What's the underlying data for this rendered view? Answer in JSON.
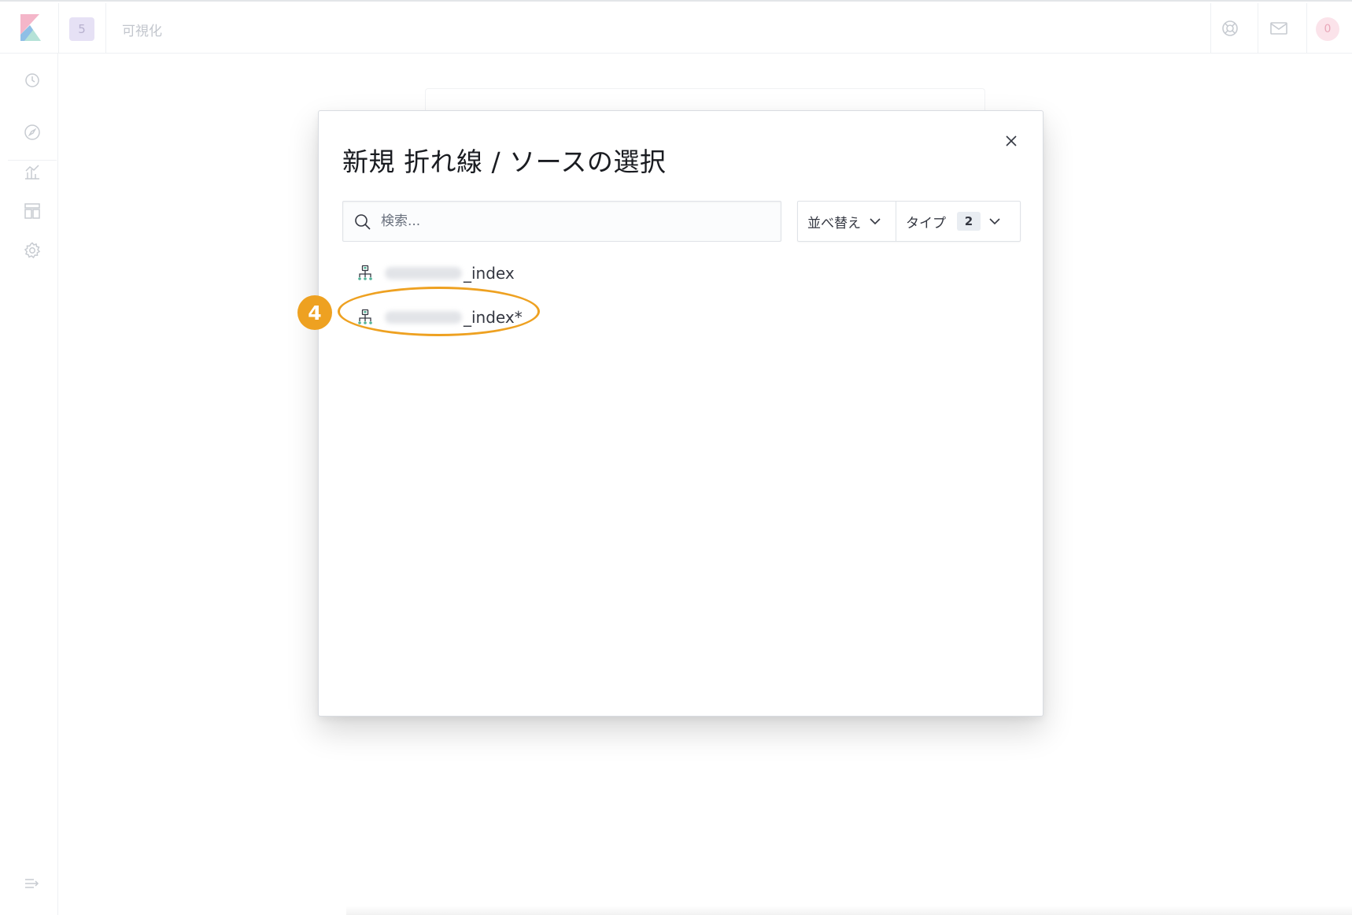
{
  "header": {
    "space_initial": "5",
    "breadcrumb": "可視化",
    "notification_count": "0"
  },
  "modal": {
    "title": "新規 折れ線 / ソースの選択",
    "search_placeholder": "検索...",
    "sort_label": "並べ替え",
    "type_label": "タイプ",
    "type_count": "2",
    "results": [
      {
        "name": "_index",
        "icon": "index-pattern-icon"
      },
      {
        "name": "_index*",
        "icon": "index-pattern-icon"
      }
    ]
  },
  "annotation": {
    "step_number": "4",
    "color": "#eea121"
  },
  "colors": {
    "text": "#343741",
    "title": "#1a1c21",
    "index_icon": "#54b399",
    "annotation": "#eea121"
  }
}
